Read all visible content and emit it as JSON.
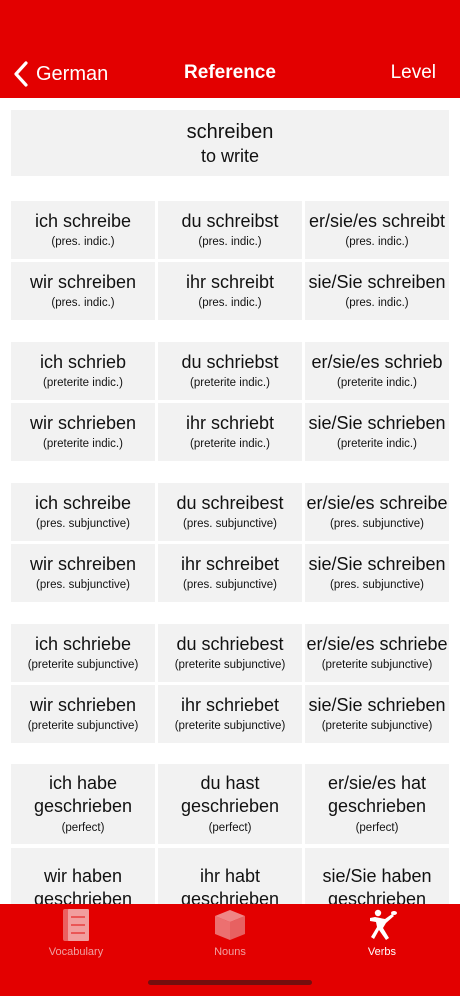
{
  "nav": {
    "back_label": "German",
    "title": "Reference",
    "right_label": "Level"
  },
  "verb": {
    "infinitive": "schreiben",
    "translation": "to write"
  },
  "rows": [
    {
      "cells": [
        {
          "form": "ich schreibe",
          "tense": "(pres. indic.)"
        },
        {
          "form": "du schreibst",
          "tense": "(pres. indic.)"
        },
        {
          "form": "er/sie/es schreibt",
          "tense": "(pres. indic.)"
        }
      ]
    },
    {
      "cells": [
        {
          "form": "wir schreiben",
          "tense": "(pres. indic.)"
        },
        {
          "form": "ihr schreibt",
          "tense": "(pres. indic.)"
        },
        {
          "form": "sie/Sie schreiben",
          "tense": "(pres. indic.)"
        }
      ]
    },
    {
      "cells": [
        {
          "form": "ich schrieb",
          "tense": "(preterite indic.)"
        },
        {
          "form": "du schriebst",
          "tense": "(preterite indic.)"
        },
        {
          "form": "er/sie/es schrieb",
          "tense": "(preterite indic.)"
        }
      ]
    },
    {
      "cells": [
        {
          "form": "wir schrieben",
          "tense": "(preterite indic.)"
        },
        {
          "form": "ihr schriebt",
          "tense": "(preterite indic.)"
        },
        {
          "form": "sie/Sie schrieben",
          "tense": "(preterite indic.)"
        }
      ]
    },
    {
      "cells": [
        {
          "form": "ich schreibe",
          "tense": "(pres. subjunctive)"
        },
        {
          "form": "du schreibest",
          "tense": "(pres. subjunctive)"
        },
        {
          "form": "er/sie/es schreibe",
          "tense": "(pres. subjunctive)"
        }
      ]
    },
    {
      "cells": [
        {
          "form": "wir schreiben",
          "tense": "(pres. subjunctive)"
        },
        {
          "form": "ihr schreibet",
          "tense": "(pres. subjunctive)"
        },
        {
          "form": "sie/Sie schreiben",
          "tense": "(pres. subjunctive)"
        }
      ]
    },
    {
      "cells": [
        {
          "form": "ich schriebe",
          "tense": "(preterite subjunctive)"
        },
        {
          "form": "du schriebest",
          "tense": "(preterite subjunctive)"
        },
        {
          "form": "er/sie/es schriebe",
          "tense": "(preterite subjunctive)"
        }
      ]
    },
    {
      "cells": [
        {
          "form": "wir schrieben",
          "tense": "(preterite subjunctive)"
        },
        {
          "form": "ihr schriebet",
          "tense": "(preterite subjunctive)"
        },
        {
          "form": "sie/Sie schrieben",
          "tense": "(preterite subjunctive)"
        }
      ]
    },
    {
      "cells": [
        {
          "form": "ich habe geschrieben",
          "tense": "(perfect)"
        },
        {
          "form": "du hast geschrieben",
          "tense": "(perfect)"
        },
        {
          "form": "er/sie/es hat geschrieben",
          "tense": "(perfect)"
        }
      ]
    },
    {
      "cells": [
        {
          "form": "wir haben geschrieben",
          "tense": ""
        },
        {
          "form": "ihr habt geschrieben",
          "tense": ""
        },
        {
          "form": "sie/Sie haben geschrieben",
          "tense": ""
        }
      ]
    }
  ],
  "tabs": [
    {
      "label": "Vocabulary",
      "icon": "vocabulary-card-icon",
      "active": false
    },
    {
      "label": "Nouns",
      "icon": "box-icon",
      "active": false
    },
    {
      "label": "Verbs",
      "icon": "discus-thrower-icon",
      "active": true
    }
  ],
  "colors": {
    "brand_red": "#e30000",
    "cell_bg": "#f2f2f2",
    "inactive_tab_label": "#f0a0a0"
  }
}
